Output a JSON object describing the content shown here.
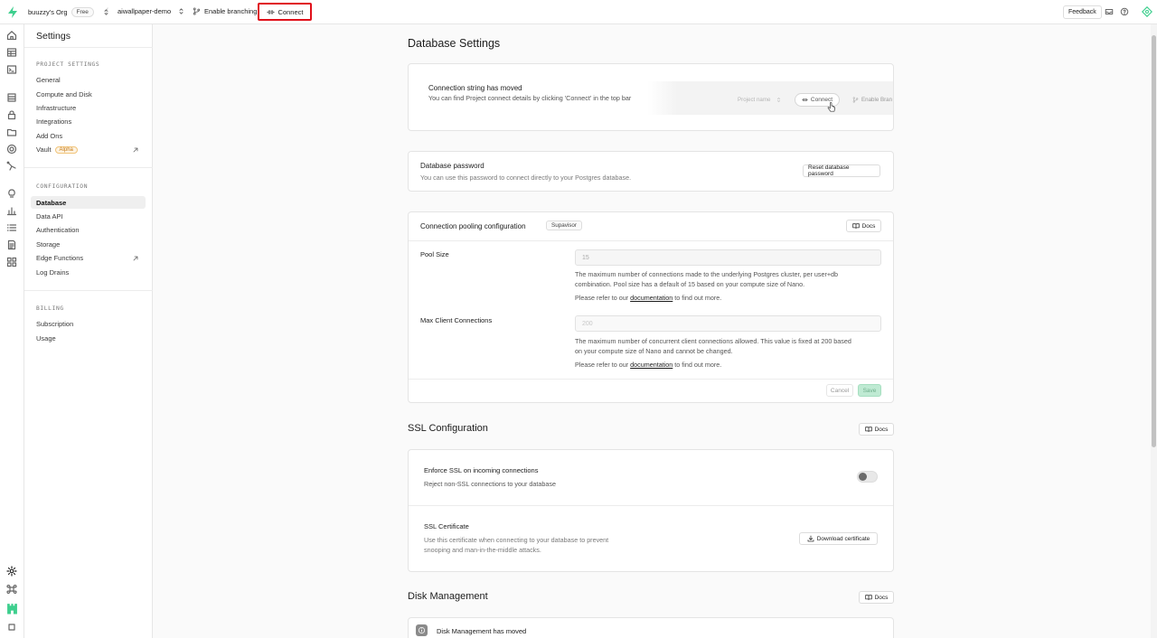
{
  "topbar": {
    "org": "buuzzy's Org",
    "plan_badge": "Free",
    "separator": "/",
    "project": "aiwallpaper-demo",
    "enable_branching": "Enable branching",
    "connect": "Connect",
    "feedback": "Feedback"
  },
  "sidebar": {
    "title": "Settings",
    "project_settings": {
      "heading": "PROJECT SETTINGS",
      "items": [
        "General",
        "Compute and Disk",
        "Infrastructure",
        "Integrations",
        "Add Ons",
        "Vault"
      ],
      "vault_badge": "Alpha"
    },
    "configuration": {
      "heading": "CONFIGURATION",
      "items": [
        "Database",
        "Data API",
        "Authentication",
        "Storage",
        "Edge Functions",
        "Log Drains"
      ]
    },
    "billing": {
      "heading": "BILLING",
      "items": [
        "Subscription",
        "Usage"
      ]
    }
  },
  "main": {
    "title": "Database Settings",
    "notice": {
      "title": "Connection string has moved",
      "body": "You can find Project connect details by clicking 'Connect' in the top bar",
      "preview_project": "Project name",
      "preview_connect": "Connect",
      "preview_branch": "Enable Bran"
    },
    "password": {
      "title": "Database password",
      "desc": "You can use this password to connect directly to your Postgres database.",
      "reset_button": "Reset database password"
    },
    "pooling": {
      "title": "Connection pooling configuration",
      "badge": "Supavisor",
      "docs": "Docs",
      "pool_size_label": "Pool Size",
      "pool_size_value": "15",
      "pool_size_help_1": "The maximum number of connections made to the underlying Postgres cluster, per user+db",
      "pool_size_help_2": "combination. Pool size has a default of 15 based on your compute size of Nano.",
      "refer_prefix": "Please refer to our",
      "refer_link": "documentation",
      "refer_suffix": "to find out more.",
      "max_client_label": "Max Client Connections",
      "max_client_value": "200",
      "max_client_help_1": "The maximum number of concurrent client connections allowed. This value is fixed at 200 based",
      "max_client_help_2": "on your compute size of Nano and cannot be changed.",
      "cancel": "Cancel",
      "save": "Save"
    },
    "ssl": {
      "title": "SSL Configuration",
      "docs": "Docs",
      "enforce_title": "Enforce SSL on incoming connections",
      "enforce_desc": "Reject non-SSL connections to your database",
      "enforce_enabled": false,
      "cert_title": "SSL Certificate",
      "cert_desc_1": "Use this certificate when connecting to your database to prevent",
      "cert_desc_2": "snooping and man-in-the-middle attacks.",
      "download": "Download certificate"
    },
    "disk": {
      "title": "Disk Management",
      "docs": "Docs",
      "notice": "Disk Management has moved"
    }
  },
  "colors": {
    "brand": "#3ecf8e",
    "highlight": "#e0101a",
    "save_bg": "#bfead3"
  }
}
